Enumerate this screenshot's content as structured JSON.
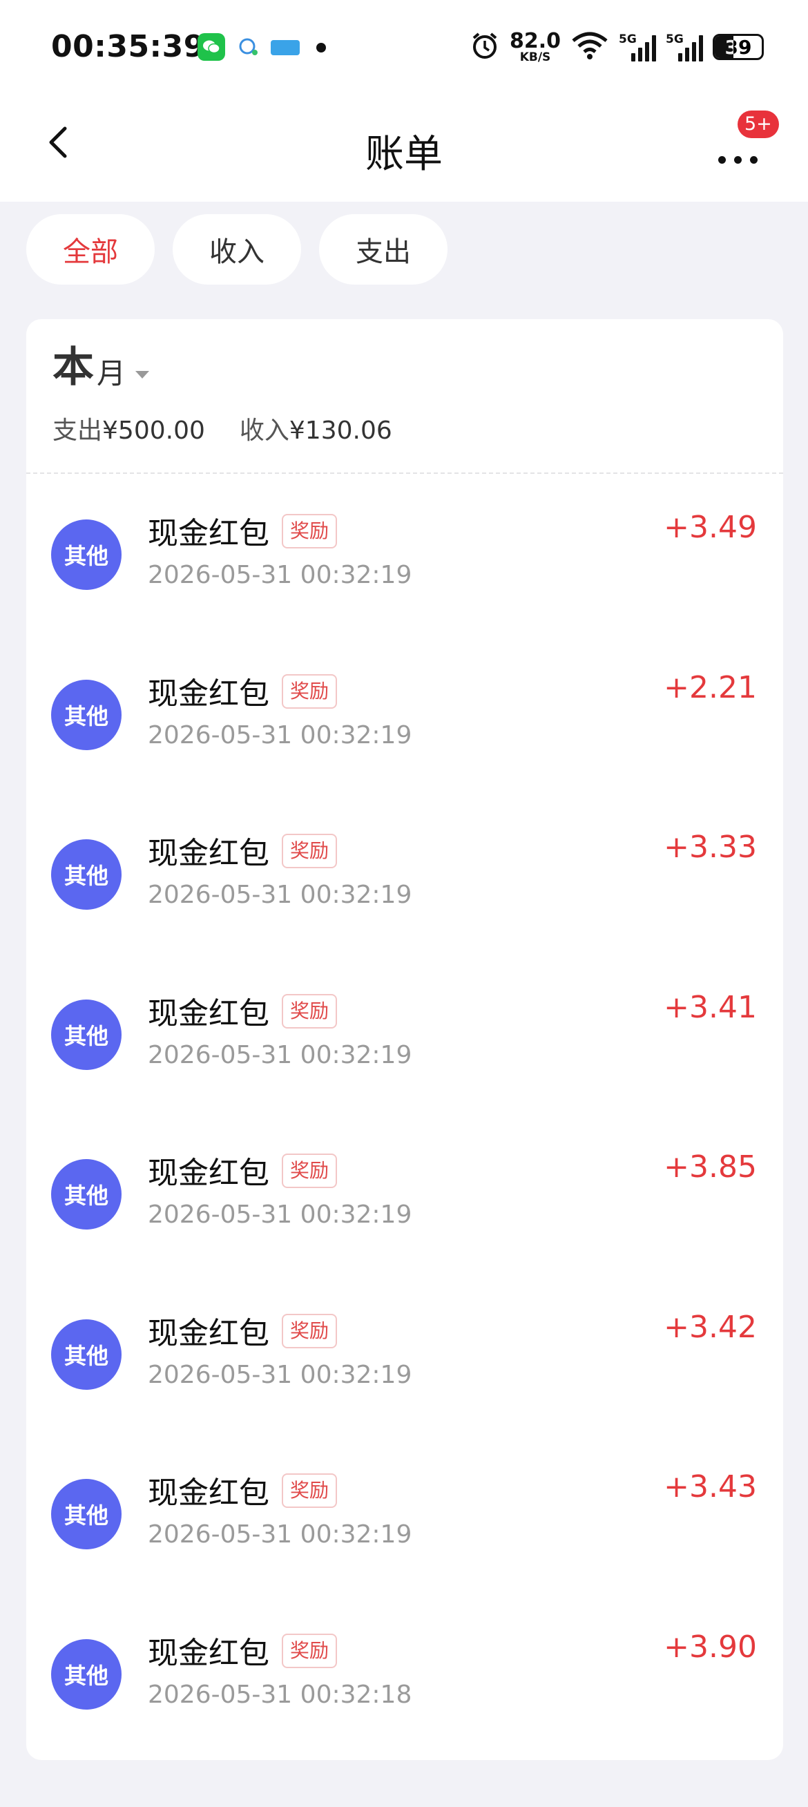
{
  "status_bar": {
    "time": "00:35:39",
    "net_speed": "82.0",
    "net_unit": "KB/S",
    "signal_label": "5G",
    "battery": "39"
  },
  "nav": {
    "title": "账单",
    "badge": "5+"
  },
  "tabs": [
    {
      "label": "全部",
      "active": true
    },
    {
      "label": "收入",
      "active": false
    },
    {
      "label": "支出",
      "active": false
    }
  ],
  "period": {
    "big": "本",
    "small": "月"
  },
  "summary": {
    "expense_label": "支出",
    "expense_amount": "¥500.00",
    "income_label": "收入",
    "income_amount": "¥130.06"
  },
  "transactions": [
    {
      "category": "其他",
      "title": "现金红包",
      "tag": "奖励",
      "time": "2026-05-31 00:32:19",
      "amount": "+3.49"
    },
    {
      "category": "其他",
      "title": "现金红包",
      "tag": "奖励",
      "time": "2026-05-31 00:32:19",
      "amount": "+2.21"
    },
    {
      "category": "其他",
      "title": "现金红包",
      "tag": "奖励",
      "time": "2026-05-31 00:32:19",
      "amount": "+3.33"
    },
    {
      "category": "其他",
      "title": "现金红包",
      "tag": "奖励",
      "time": "2026-05-31 00:32:19",
      "amount": "+3.41"
    },
    {
      "category": "其他",
      "title": "现金红包",
      "tag": "奖励",
      "time": "2026-05-31 00:32:19",
      "amount": "+3.85"
    },
    {
      "category": "其他",
      "title": "现金红包",
      "tag": "奖励",
      "time": "2026-05-31 00:32:19",
      "amount": "+3.42"
    },
    {
      "category": "其他",
      "title": "现金红包",
      "tag": "奖励",
      "time": "2026-05-31 00:32:19",
      "amount": "+3.43"
    },
    {
      "category": "其他",
      "title": "现金红包",
      "tag": "奖励",
      "time": "2026-05-31 00:32:18",
      "amount": "+3.90"
    }
  ],
  "colors": {
    "accent_red": "#e4393c",
    "avatar_blue": "#5b67f0",
    "background": "#f2f2f7"
  }
}
